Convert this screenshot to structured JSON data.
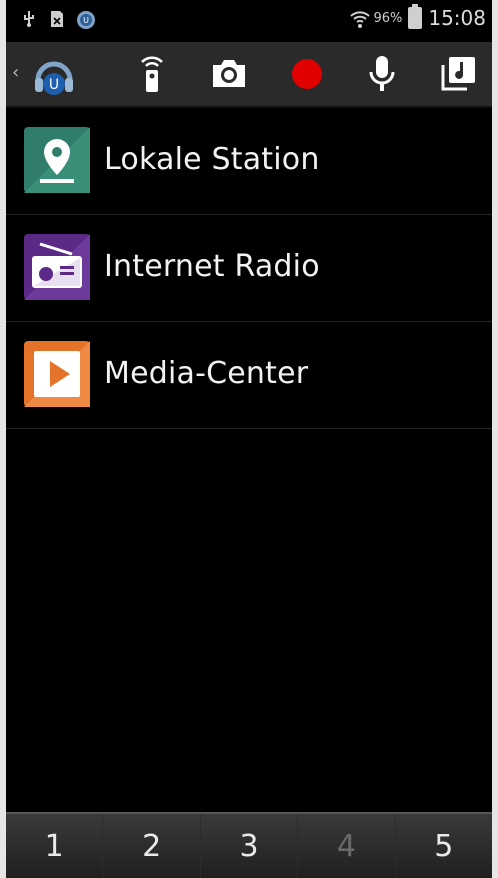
{
  "status_bar": {
    "icons_left": [
      "usb-icon",
      "sim-missing-icon",
      "app-notification-icon"
    ],
    "wifi_icon": "wifi-icon",
    "battery_percent": "96%",
    "time": "15:08"
  },
  "action_bar": {
    "back_glyph": "‹",
    "app_icon": "headphones-u-icon",
    "buttons": [
      "remote-icon",
      "camera-icon",
      "record-icon",
      "microphone-icon",
      "music-library-icon"
    ],
    "record_color": "#e00000"
  },
  "list": {
    "items": [
      {
        "label": "Lokale Station",
        "icon": "location-pin-icon",
        "color": "#2f7d6a"
      },
      {
        "label": "Internet Radio",
        "icon": "radio-icon",
        "color": "#5b2a86"
      },
      {
        "label": "Media-Center",
        "icon": "play-icon",
        "color": "#e5742a"
      }
    ]
  },
  "bottom_bar": {
    "tabs": [
      {
        "label": "1",
        "active": true
      },
      {
        "label": "2",
        "active": true
      },
      {
        "label": "3",
        "active": true
      },
      {
        "label": "4",
        "active": false
      },
      {
        "label": "5",
        "active": true
      }
    ]
  }
}
